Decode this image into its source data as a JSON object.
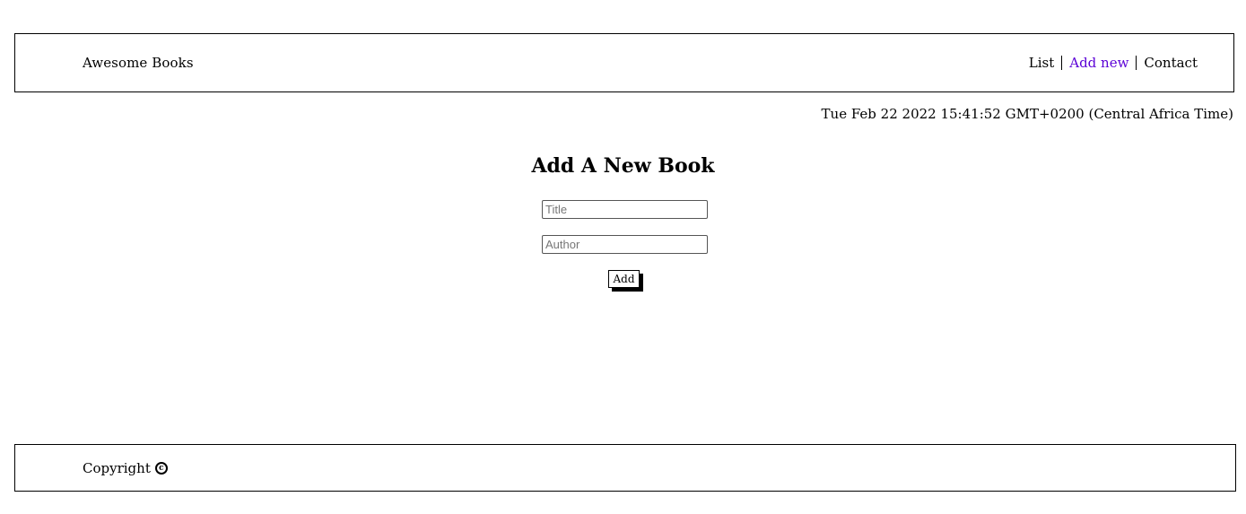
{
  "header": {
    "brand": "Awesome Books",
    "nav": [
      {
        "label": "List",
        "active": false
      },
      {
        "label": "Add new",
        "active": true
      },
      {
        "label": "Contact",
        "active": false
      }
    ]
  },
  "datetime": "Tue Feb 22 2022 15:41:52 GMT+0200 (Central Africa Time)",
  "form": {
    "heading": "Add A New Book",
    "title_placeholder": "Title",
    "author_placeholder": "Author",
    "submit_label": "Add"
  },
  "footer": {
    "copyright_text": "Copyright",
    "copyright_icon": "copyright-icon"
  },
  "colors": {
    "active_link": "#5b00d6",
    "border": "#000000"
  }
}
